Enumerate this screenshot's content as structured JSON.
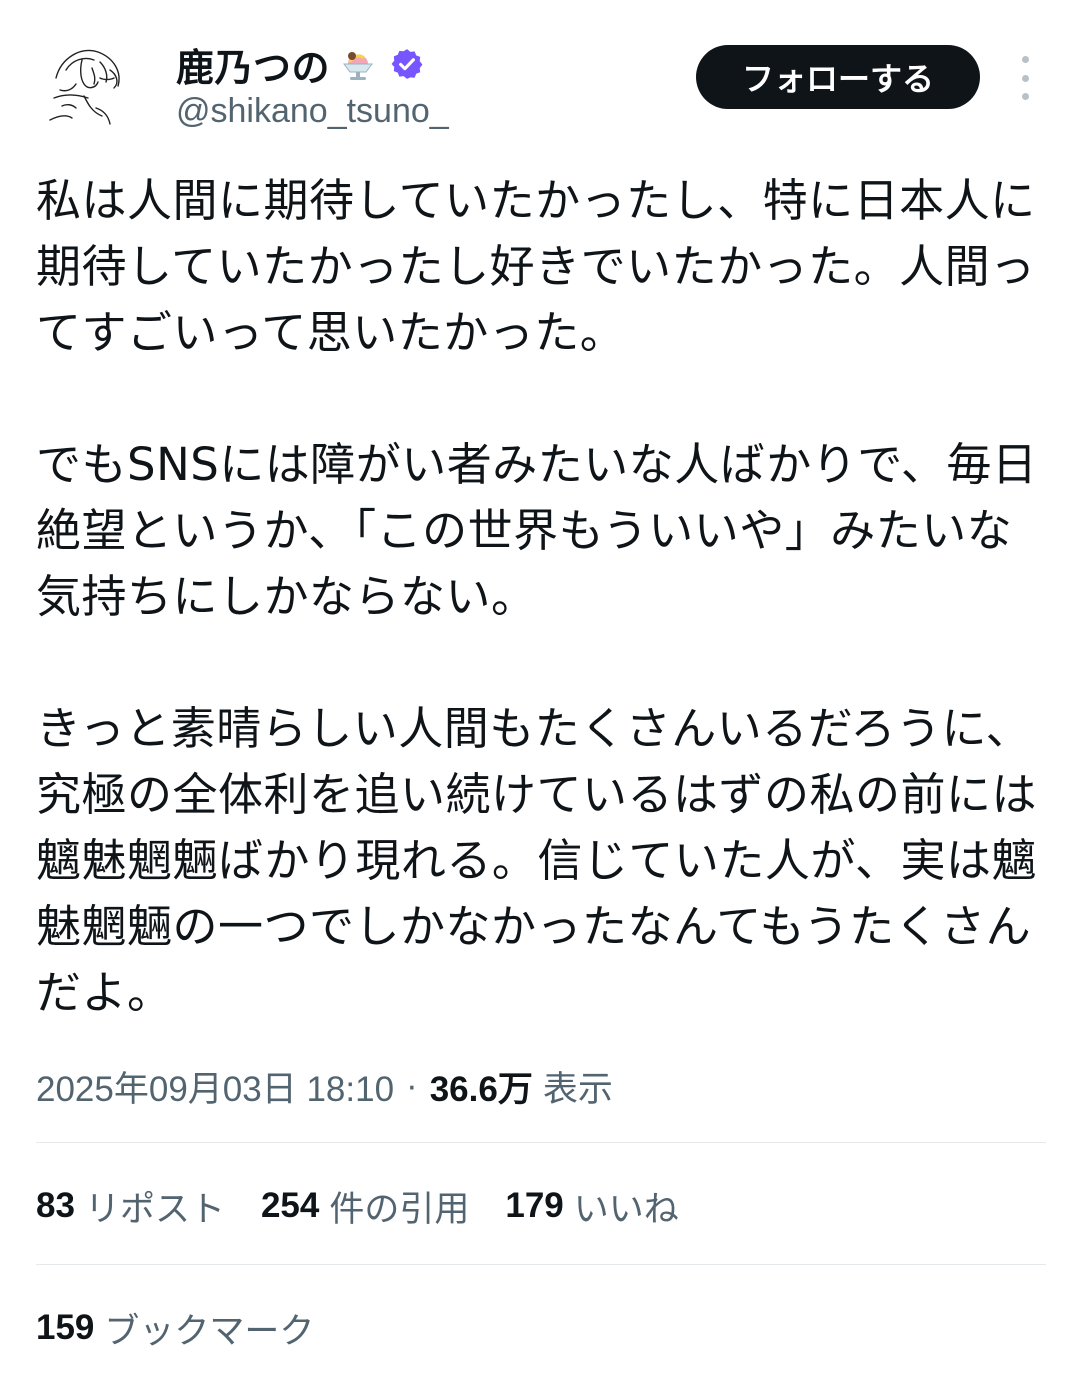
{
  "header": {
    "display_name": "鹿乃つの",
    "emoji_icon": "shaved-ice-dessert-emoji",
    "verified_icon": "verified-badge-icon",
    "handle": "@shikano_tsuno_",
    "follow_label": "フォローする",
    "more_icon": "more-vertical-icon"
  },
  "tweet": {
    "paragraphs": [
      "私は人間に期待していたかったし、特に日本人に期待していたかったし好きでいたかった。人間ってすごいって思いたかった。",
      "でもSNSには障がい者みたいな人ばかりで、毎日絶望というか、「この世界もういいや」みたいな気持ちにしかならない。",
      "きっと素晴らしい人間もたくさんいるだろうに、究極の全体利を追い続けているはずの私の前には魑魅魍魎ばかり現れる。信じていた人が、実は魑魅魍魎の一つでしかなかったなんてもうたくさんだよ。"
    ]
  },
  "meta": {
    "timestamp": "2025年09月03日 18:10",
    "separator": "·",
    "views_count": "36.6万",
    "views_label": "表示"
  },
  "stats": {
    "reposts": {
      "count": "83",
      "label": "リポスト"
    },
    "quotes": {
      "count": "254",
      "label": "件の引用"
    },
    "likes": {
      "count": "179",
      "label": "いいね"
    },
    "bookmarks": {
      "count": "159",
      "label": "ブックマーク"
    }
  },
  "colors": {
    "text": "#0f1419",
    "secondary": "#536471",
    "verified": "#7856ff",
    "button_bg": "#0f1419",
    "divider": "#e6e9ec"
  }
}
